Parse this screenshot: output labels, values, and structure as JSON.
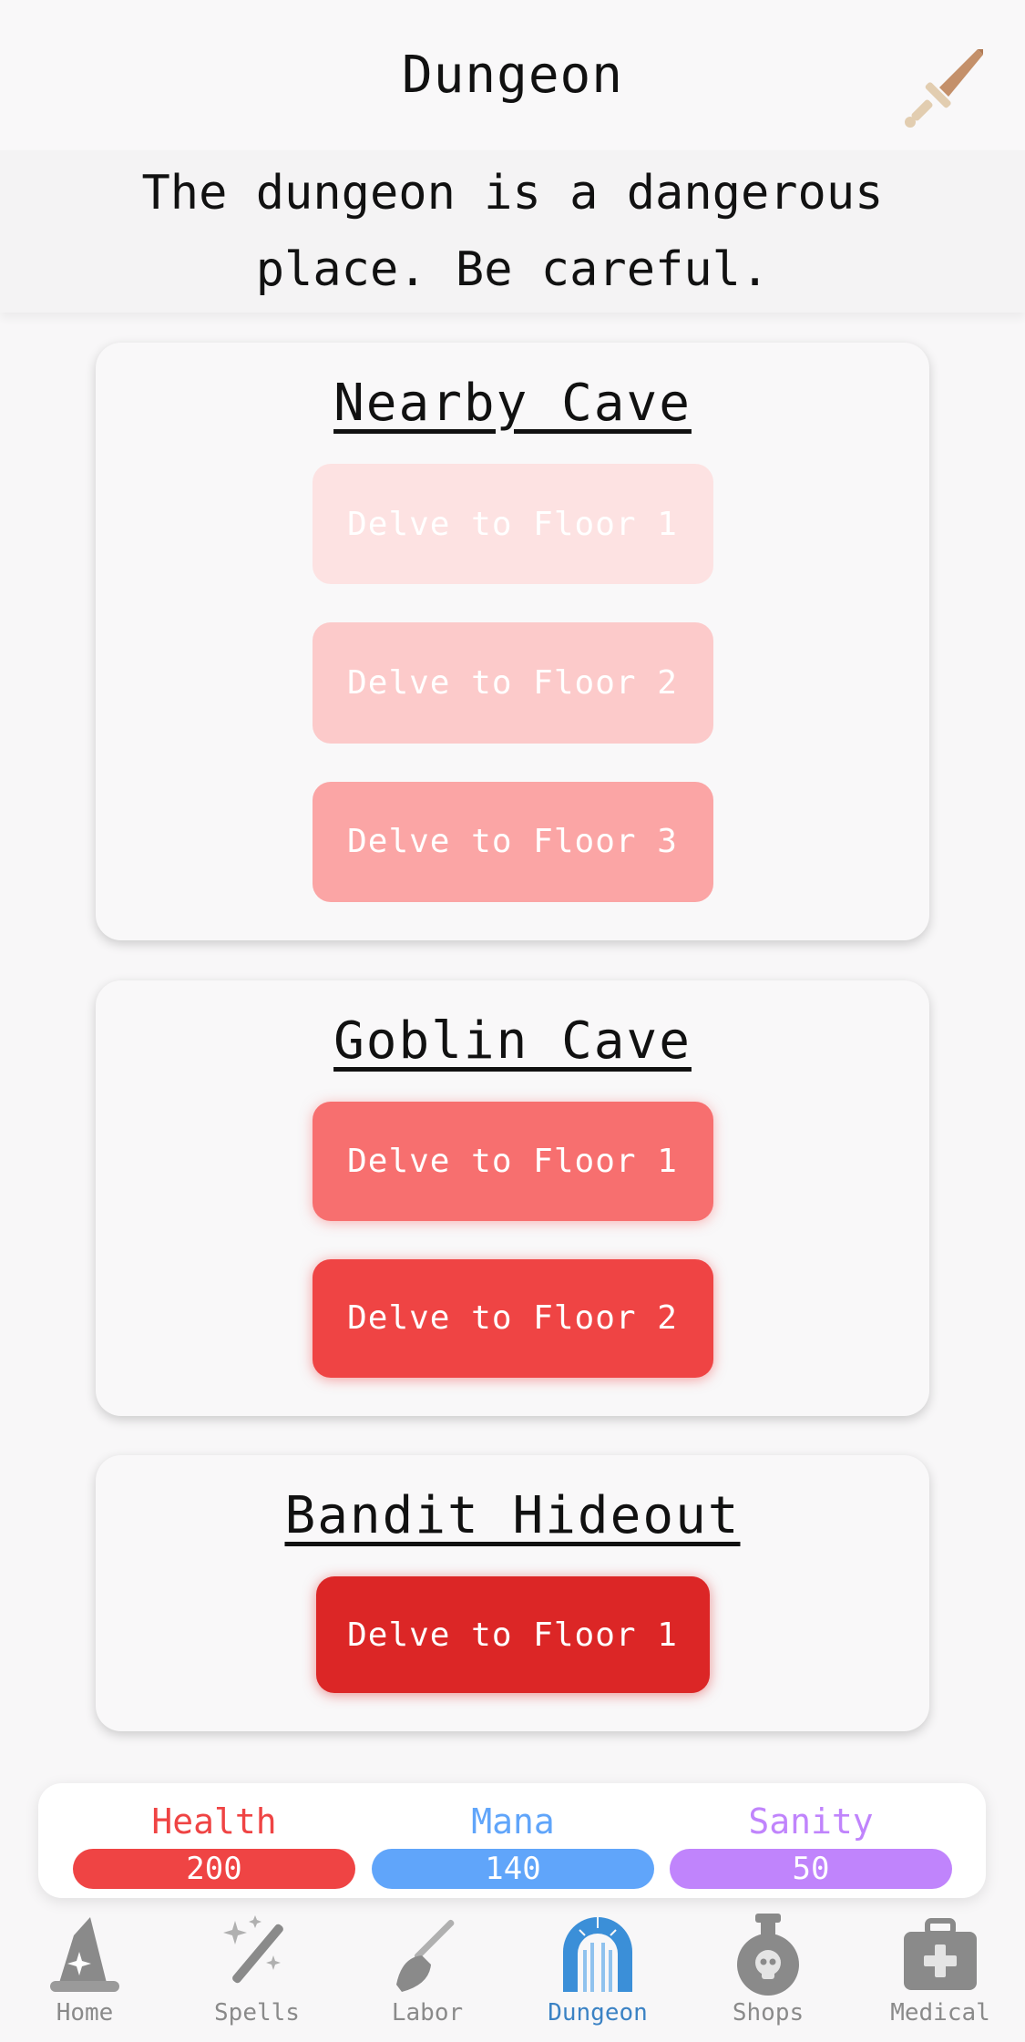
{
  "header": {
    "title": "Dungeon",
    "icon": "sword-icon"
  },
  "subtitle": "The dungeon is a dangerous place. Be careful.",
  "dungeons": [
    {
      "name": "Nearby Cave",
      "floors": [
        {
          "label": "Delve to Floor 1",
          "color": "#fde2e2"
        },
        {
          "label": "Delve to Floor 2",
          "color": "#fccaca"
        },
        {
          "label": "Delve to Floor 3",
          "color": "#fba5a5"
        }
      ]
    },
    {
      "name": "Goblin Cave",
      "floors": [
        {
          "label": "Delve to Floor 1",
          "color": "#f76f6f"
        },
        {
          "label": "Delve to Floor 2",
          "color": "#ef4444"
        }
      ]
    },
    {
      "name": "Bandit Hideout",
      "floors": [
        {
          "label": "Delve to Floor 1",
          "color": "#dc2626"
        }
      ]
    }
  ],
  "stats": {
    "health": {
      "label": "Health",
      "value": "200",
      "color": "#ef4444"
    },
    "mana": {
      "label": "Mana",
      "value": "140",
      "color": "#60a5fa"
    },
    "sanity": {
      "label": "Sanity",
      "value": "50",
      "color": "#c084fc"
    }
  },
  "nav": {
    "items": [
      {
        "label": "Home",
        "icon": "wizard-hat-icon"
      },
      {
        "label": "Spells",
        "icon": "magic-wand-icon"
      },
      {
        "label": "Labor",
        "icon": "broom-icon"
      },
      {
        "label": "Dungeon",
        "icon": "dungeon-gate-icon",
        "active": true
      },
      {
        "label": "Shops",
        "icon": "potion-skull-icon"
      },
      {
        "label": "Medical",
        "icon": "medical-kit-icon"
      }
    ]
  }
}
